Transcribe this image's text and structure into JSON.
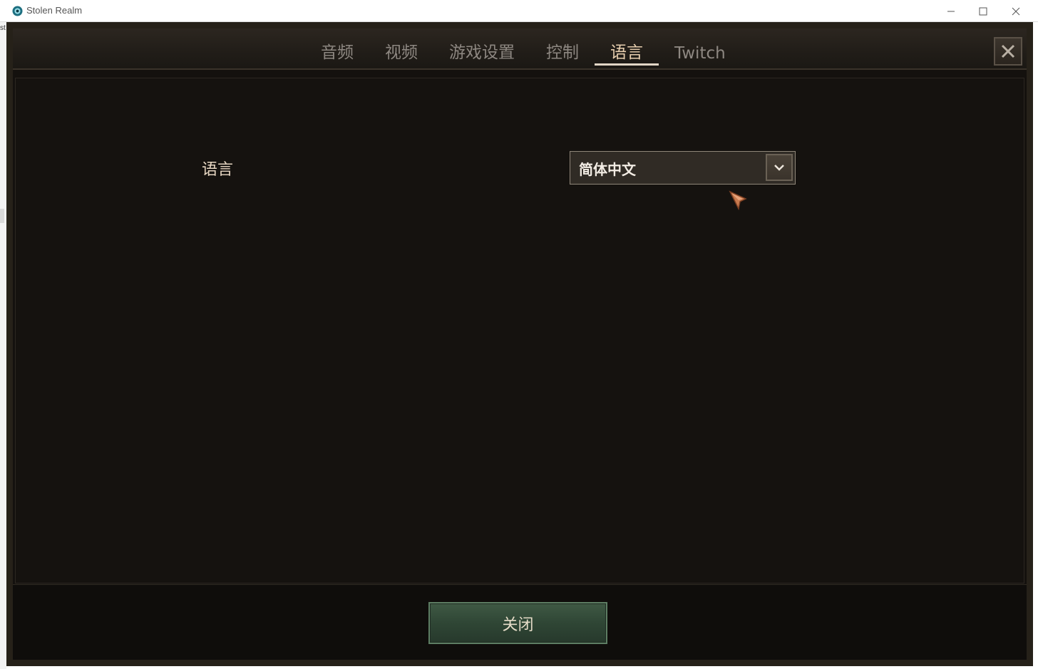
{
  "window": {
    "title": "Stolen Realm",
    "minimize_icon": "minimize-icon",
    "maximize_icon": "maximize-icon",
    "close_icon": "close-icon"
  },
  "desktop": {
    "edge_text": "st"
  },
  "settings": {
    "tabs": [
      {
        "label": "音频",
        "active": false
      },
      {
        "label": "视频",
        "active": false
      },
      {
        "label": "游戏设置",
        "active": false
      },
      {
        "label": "控制",
        "active": false
      },
      {
        "label": "语言",
        "active": true
      },
      {
        "label": "Twitch",
        "active": false
      }
    ],
    "close_icon": "close-x-icon",
    "language_label": "语言",
    "language_dropdown": {
      "value": "简体中文",
      "icon": "chevron-down-icon"
    },
    "close_button_label": "关闭"
  },
  "colors": {
    "accent_text": "#e8cfaf",
    "button_green": "#2f4635",
    "panel_bg": "#15120f"
  }
}
